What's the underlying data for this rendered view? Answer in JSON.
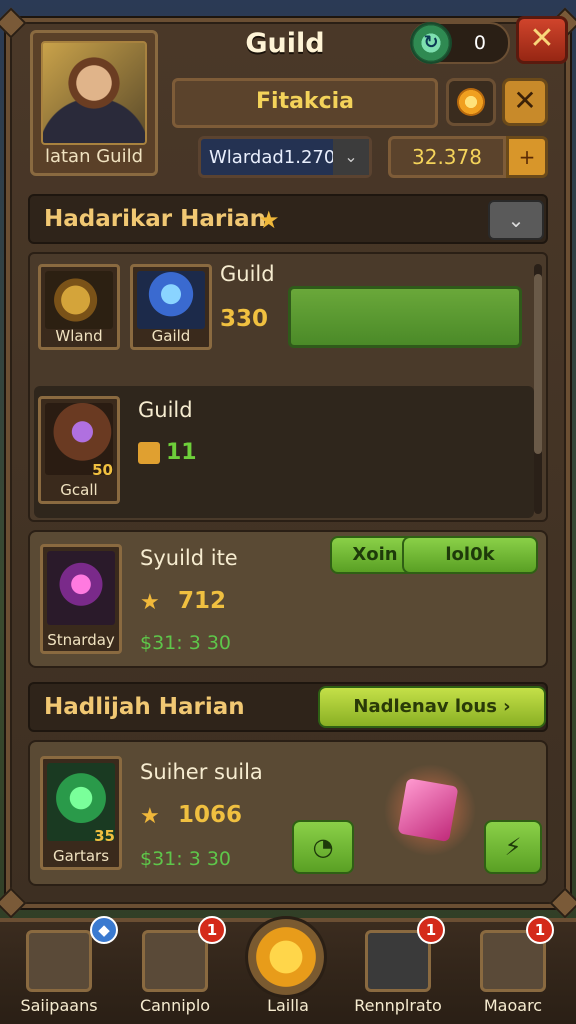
{
  "header": {
    "title": "Guild",
    "portrait_label": "latan Guild",
    "gems": "0",
    "close_label": "✕",
    "name_field": "Fitakcia",
    "x_label": "✕",
    "select_value": "Wlardad1.270",
    "gold_value": "32.378",
    "add_label": "+"
  },
  "section1": {
    "title": "Hadarikar Harian",
    "badge": "★",
    "dropdown": "⌄"
  },
  "guild_panel": {
    "row1": {
      "title": "Guild",
      "value": "330",
      "icon1_caption": "Wland",
      "icon2_caption": "Gaild"
    },
    "row2": {
      "title": "Guild",
      "value": "11",
      "icon_caption": "Gcall",
      "icon_number": "50"
    }
  },
  "card1": {
    "title": "Syuild ite",
    "value": "712",
    "sub": "$31: 3 30",
    "icon_caption": "Stnarday",
    "btn_left": "Xoin",
    "btn_right": "lol0k"
  },
  "section2": {
    "title": "Hadlijah Harian",
    "btn_label": "Nadlenav lous"
  },
  "card2": {
    "title": "Suiher suila",
    "value": "1066",
    "sub": "$31: 3 30",
    "icon_caption": "Gartars",
    "icon_number": "35"
  },
  "bottom_nav": [
    {
      "label": "Saiipaans",
      "badge": ""
    },
    {
      "label": "Canniplo",
      "badge": "1"
    },
    {
      "label": "Lailla",
      "badge": ""
    },
    {
      "label": "Rennplrato",
      "badge": "1"
    },
    {
      "label": "Maoarc",
      "badge": "1"
    }
  ]
}
